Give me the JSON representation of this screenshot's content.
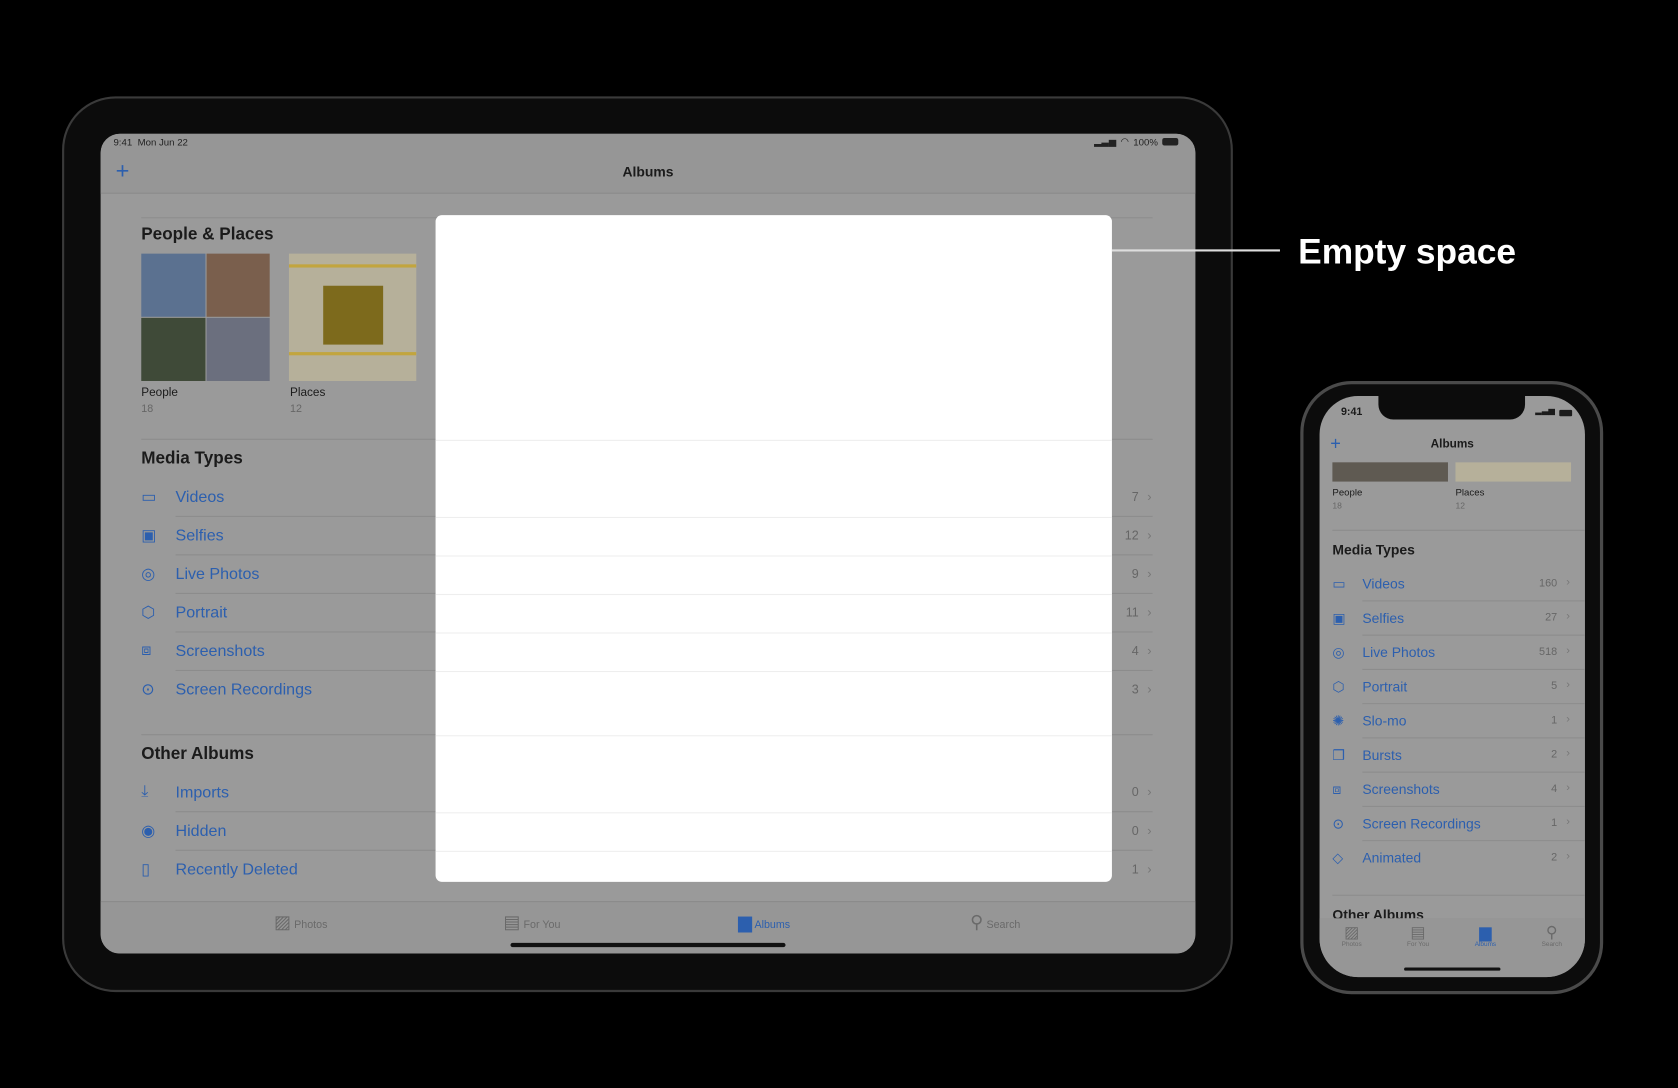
{
  "annotation": {
    "label": "Empty space",
    "color": "#ffffff"
  },
  "colors": {
    "accent": "#2c5fae",
    "dim_background": "#9a9a9a",
    "panel": "#ffffff"
  },
  "ipad": {
    "status": {
      "time": "9:41",
      "date": "Mon Jun 22",
      "battery": "100%"
    },
    "nav": {
      "title": "Albums",
      "add_icon": "plus-icon"
    },
    "people_places": {
      "heading": "People & Places",
      "people": {
        "label": "People",
        "count": "18"
      },
      "places": {
        "label": "Places",
        "count": "12"
      }
    },
    "media_types": {
      "heading": "Media Types",
      "items": [
        {
          "icon": "video-icon",
          "label": "Videos",
          "count": "7"
        },
        {
          "icon": "selfie-icon",
          "label": "Selfies",
          "count": "12"
        },
        {
          "icon": "live-photo-icon",
          "label": "Live Photos",
          "count": "9"
        },
        {
          "icon": "cube-icon",
          "label": "Portrait",
          "count": "11"
        },
        {
          "icon": "screenshot-icon",
          "label": "Screenshots",
          "count": "4"
        },
        {
          "icon": "record-icon",
          "label": "Screen Recordings",
          "count": "3"
        }
      ]
    },
    "other_albums": {
      "heading": "Other Albums",
      "items": [
        {
          "icon": "import-icon",
          "label": "Imports",
          "count": "0"
        },
        {
          "icon": "eye-slash-icon",
          "label": "Hidden",
          "count": "0"
        },
        {
          "icon": "trash-icon",
          "label": "Recently Deleted",
          "count": "1"
        }
      ]
    },
    "tabs": [
      {
        "icon": "photos-icon",
        "label": "Photos"
      },
      {
        "icon": "for-you-icon",
        "label": "For You"
      },
      {
        "icon": "albums-icon",
        "label": "Albums",
        "active": true
      },
      {
        "icon": "search-icon",
        "label": "Search"
      }
    ]
  },
  "iphone": {
    "status": {
      "time": "9:41"
    },
    "nav": {
      "title": "Albums",
      "add_icon": "plus-icon"
    },
    "people": {
      "label": "People",
      "count": "18"
    },
    "places": {
      "label": "Places",
      "count": "12"
    },
    "media_types": {
      "heading": "Media Types",
      "items": [
        {
          "icon": "video-icon",
          "label": "Videos",
          "count": "160"
        },
        {
          "icon": "selfie-icon",
          "label": "Selfies",
          "count": "27"
        },
        {
          "icon": "live-photo-icon",
          "label": "Live Photos",
          "count": "518"
        },
        {
          "icon": "cube-icon",
          "label": "Portrait",
          "count": "5"
        },
        {
          "icon": "slomo-icon",
          "label": "Slo-mo",
          "count": "1"
        },
        {
          "icon": "bursts-icon",
          "label": "Bursts",
          "count": "2"
        },
        {
          "icon": "screenshot-icon",
          "label": "Screenshots",
          "count": "4"
        },
        {
          "icon": "record-icon",
          "label": "Screen Recordings",
          "count": "1"
        },
        {
          "icon": "animated-icon",
          "label": "Animated",
          "count": "2"
        }
      ]
    },
    "other_albums_heading": "Other Albums",
    "tabs": [
      {
        "icon": "photos-icon",
        "label": "Photos"
      },
      {
        "icon": "for-you-icon",
        "label": "For You"
      },
      {
        "icon": "albums-icon",
        "label": "Albums",
        "active": true
      },
      {
        "icon": "search-icon",
        "label": "Search"
      }
    ]
  }
}
